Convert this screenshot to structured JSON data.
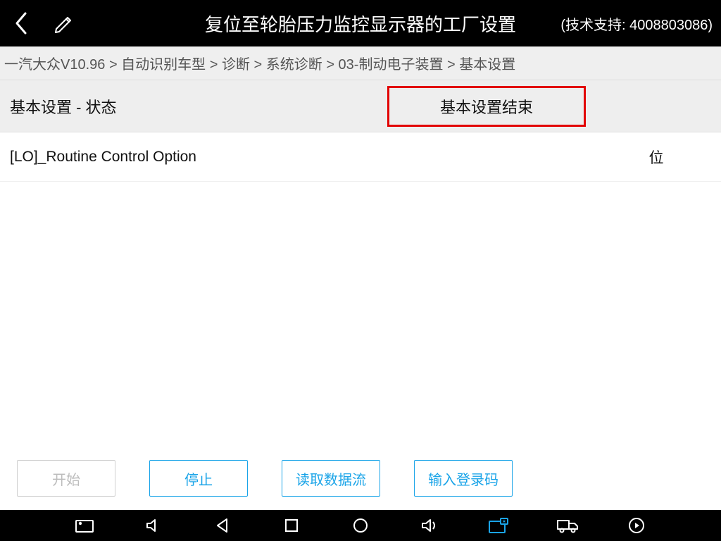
{
  "header": {
    "title": "复位至轮胎压力监控显示器的工厂设置",
    "support": "(技术支持: 4008803086)"
  },
  "breadcrumb": "一汽大众V10.96 > 自动识别车型 > 诊断 > 系统诊断 > 03-制动电子装置 > 基本设置",
  "status": {
    "label": "基本设置 - 状态",
    "value": "基本设置结束"
  },
  "row": {
    "name": "[LO]_Routine Control Option",
    "unit": "位"
  },
  "actions": {
    "start": "开始",
    "stop": "停止",
    "read_stream": "读取数据流",
    "enter_login": "输入登录码"
  },
  "colors": {
    "accent": "#1aa4e8",
    "alert": "#e20000"
  }
}
